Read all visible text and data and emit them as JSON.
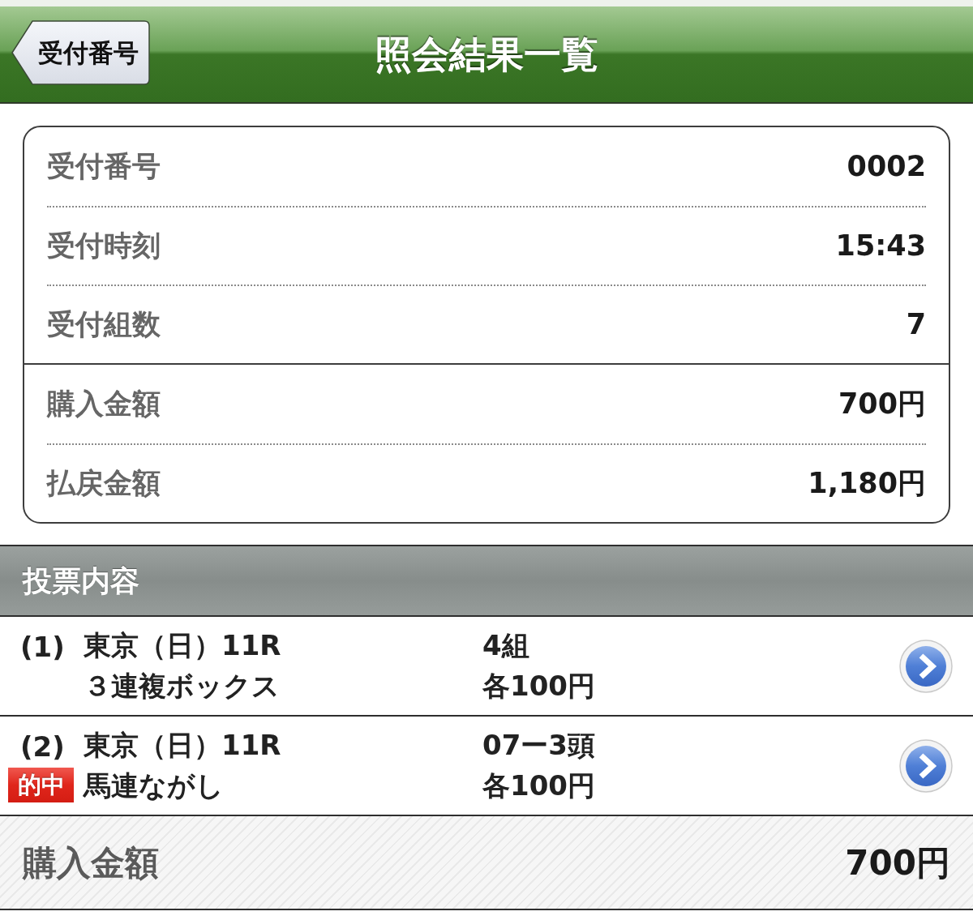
{
  "header": {
    "back_button": "受付番号",
    "title": "照会結果一覧"
  },
  "summary": {
    "groups": [
      {
        "rows": [
          {
            "label": "受付番号",
            "value": "0002"
          },
          {
            "label": "受付時刻",
            "value": "15:43"
          },
          {
            "label": "受付組数",
            "value": "7"
          }
        ]
      },
      {
        "rows": [
          {
            "label": "購入金額",
            "value": "700円"
          },
          {
            "label": "払戻金額",
            "value": "1,180円"
          }
        ]
      }
    ]
  },
  "section": {
    "title": "投票内容"
  },
  "bets": [
    {
      "index": "(1)",
      "race": "東京（日）11R",
      "bet_type": "３連複ボックス",
      "combos": "4組",
      "stake": "各100円",
      "won": false
    },
    {
      "index": "(2)",
      "race": "東京（日）11R",
      "bet_type": "馬連ながし",
      "combos": "07ー3頭",
      "stake": "各100円",
      "won": true,
      "badge": "的中"
    }
  ],
  "footer": {
    "label": "購入金額",
    "value": "700円"
  }
}
